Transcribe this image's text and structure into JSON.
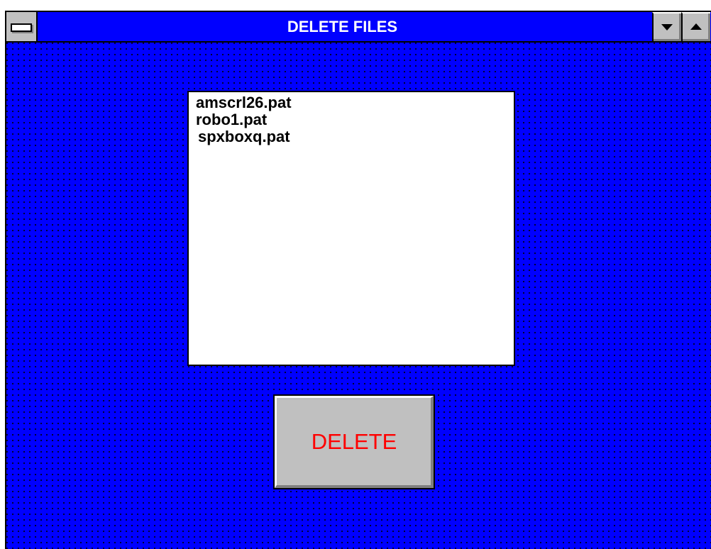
{
  "window": {
    "title": "DELETE FILES"
  },
  "titlebar": {
    "system_menu_icon": "system-menu-bar-icon",
    "minimize_icon": "down-arrow-icon",
    "maximize_icon": "up-arrow-icon"
  },
  "file_list": {
    "items": [
      "amscrl26.pat",
      "robo1.pat",
      "spxboxq.pat"
    ]
  },
  "delete_button": {
    "label": "DELETE",
    "label_color": "#ff0000"
  },
  "colors": {
    "window_background": "#0000ff",
    "dot_pattern": "#000000",
    "title_text": "#ffffff",
    "button_face": "#c0c0c0"
  }
}
